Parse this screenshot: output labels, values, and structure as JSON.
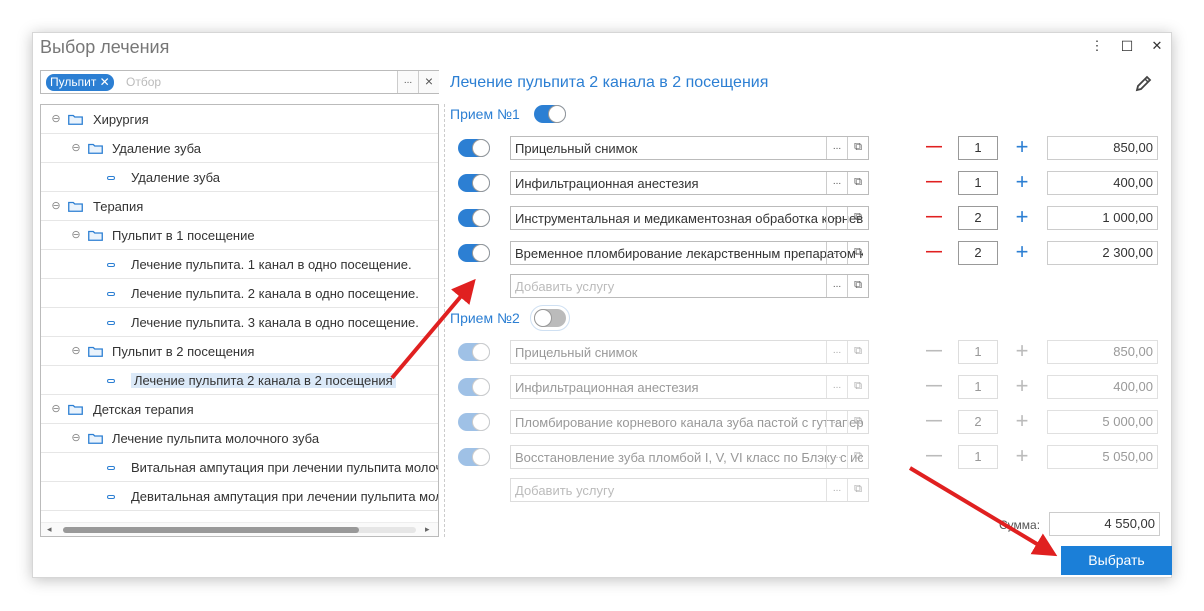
{
  "window": {
    "title": "Выбор лечения",
    "more_glyph": "⋮",
    "maximize_glyph": "☐",
    "close_glyph": "✕"
  },
  "filter": {
    "tag_label": "Пульпит",
    "tag_close_glyph": "✕",
    "placeholder": "Отбор",
    "select_glyph": "...",
    "clear_glyph": "×"
  },
  "tree": {
    "items": [
      {
        "label": "Хирургия",
        "level": 0,
        "type": "folder"
      },
      {
        "label": "Удаление зуба",
        "level": 1,
        "type": "folder"
      },
      {
        "label": "Удаление зуба",
        "level": 2,
        "type": "leaf"
      },
      {
        "label": "Терапия",
        "level": 0,
        "type": "folder"
      },
      {
        "label": "Пульпит в 1 посещение",
        "level": 1,
        "type": "folder"
      },
      {
        "label": "Лечение пульпита. 1 канал в одно посещение.",
        "level": 2,
        "type": "leaf"
      },
      {
        "label": "Лечение пульпита. 2 канала в одно посещение.",
        "level": 2,
        "type": "leaf"
      },
      {
        "label": "Лечение пульпита. 3 канала в одно посещение.",
        "level": 2,
        "type": "leaf"
      },
      {
        "label": "Пульпит в 2 посещения",
        "level": 1,
        "type": "folder"
      },
      {
        "label": "Лечение пульпита 2 канала в 2 посещения",
        "level": 2,
        "type": "leaf",
        "selected": true
      },
      {
        "label": "Детская терапия",
        "level": 0,
        "type": "folder"
      },
      {
        "label": "Лечение пульпита молочного зуба",
        "level": 1,
        "type": "folder"
      },
      {
        "label": "Витальная ампутация при лечении пульпита молочного зуба",
        "level": 2,
        "type": "leaf"
      },
      {
        "label": "Девитальная ампутация при лечении пульпита молочного зуба",
        "level": 2,
        "type": "leaf"
      }
    ],
    "collapse_glyph": "⊖",
    "scroll_left_glyph": "◂",
    "scroll_right_glyph": "▸"
  },
  "detail": {
    "title": "Лечение пульпита 2 канала в 2 посещения",
    "edit_icon": "pencil-icon",
    "visits": [
      {
        "label": "Прием №1",
        "enabled": true,
        "services": [
          {
            "name": "Прицельный снимок",
            "qty": "1",
            "price": "850,00"
          },
          {
            "name": "Инфильтрационная анестезия",
            "qty": "1",
            "price": "400,00"
          },
          {
            "name": "Инструментальная и медикаментозная обработка корнево",
            "qty": "2",
            "price": "1 000,00"
          },
          {
            "name": "Временное пломбирование лекарственным препаратом ко",
            "qty": "2",
            "price": "2 300,00"
          }
        ],
        "add_placeholder": "Добавить услугу"
      },
      {
        "label": "Прием №2",
        "enabled": false,
        "services": [
          {
            "name": "Прицельный снимок",
            "qty": "1",
            "price": "850,00"
          },
          {
            "name": "Инфильтрационная анестезия",
            "qty": "1",
            "price": "400,00"
          },
          {
            "name": "Пломбирование корневого канала зуба пастой с гуттаперч",
            "qty": "2",
            "price": "5 000,00"
          },
          {
            "name": "Восстановление зуба пломбой I, V, VI класс по Блэку с ис",
            "qty": "1",
            "price": "5 050,00"
          }
        ],
        "add_placeholder": "Добавить услугу"
      }
    ],
    "select_glyph": "...",
    "open_glyph": "⧉",
    "minus_glyph": "—",
    "plus_glyph": "+",
    "sum_label": "Сумма:",
    "sum_value": "4 550,00",
    "choose_button": "Выбрать"
  },
  "colors": {
    "accent": "#2c7fd3",
    "minus": "#e02020",
    "annotation_arrow": "#e02020"
  }
}
